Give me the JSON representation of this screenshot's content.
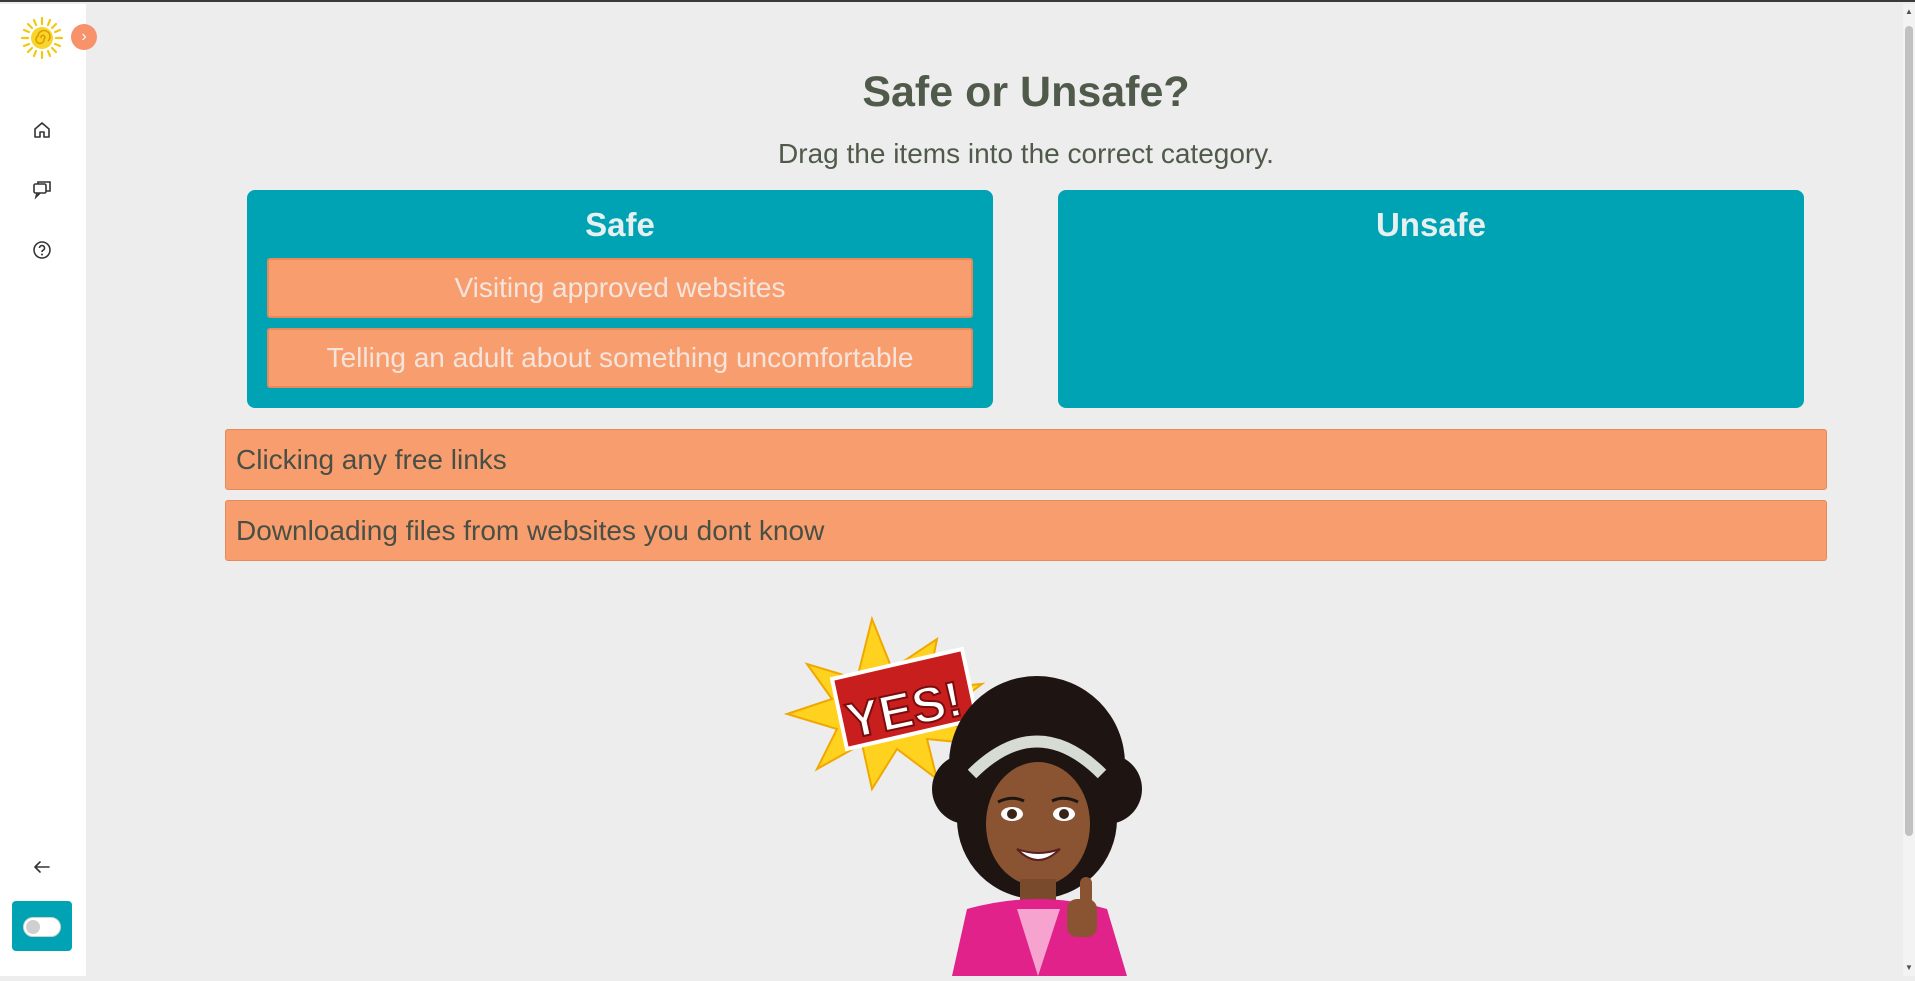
{
  "sidebar": {
    "expand_glyph": "›",
    "icons": [
      "sun-logo-icon",
      "home-icon",
      "chat-icon",
      "help-icon",
      "back-arrow-icon",
      "toggle-switch"
    ]
  },
  "activity": {
    "title": "Safe or Unsafe?",
    "instructions": "Drag the items into the correct category."
  },
  "categories": [
    {
      "label": "Safe",
      "items": [
        "Visiting approved websites",
        "Telling an adult about something uncomfortable"
      ]
    },
    {
      "label": "Unsafe",
      "items": []
    }
  ],
  "unsorted_items": [
    "Clicking any free links",
    "Downloading files from websites you dont know"
  ],
  "feedback": {
    "text": "YES!",
    "icon": "thumbs-up-character"
  },
  "colors": {
    "accent": "#00a3b4",
    "item": "#f89e6e",
    "heading": "#4f5a4a",
    "background": "#ededed"
  }
}
